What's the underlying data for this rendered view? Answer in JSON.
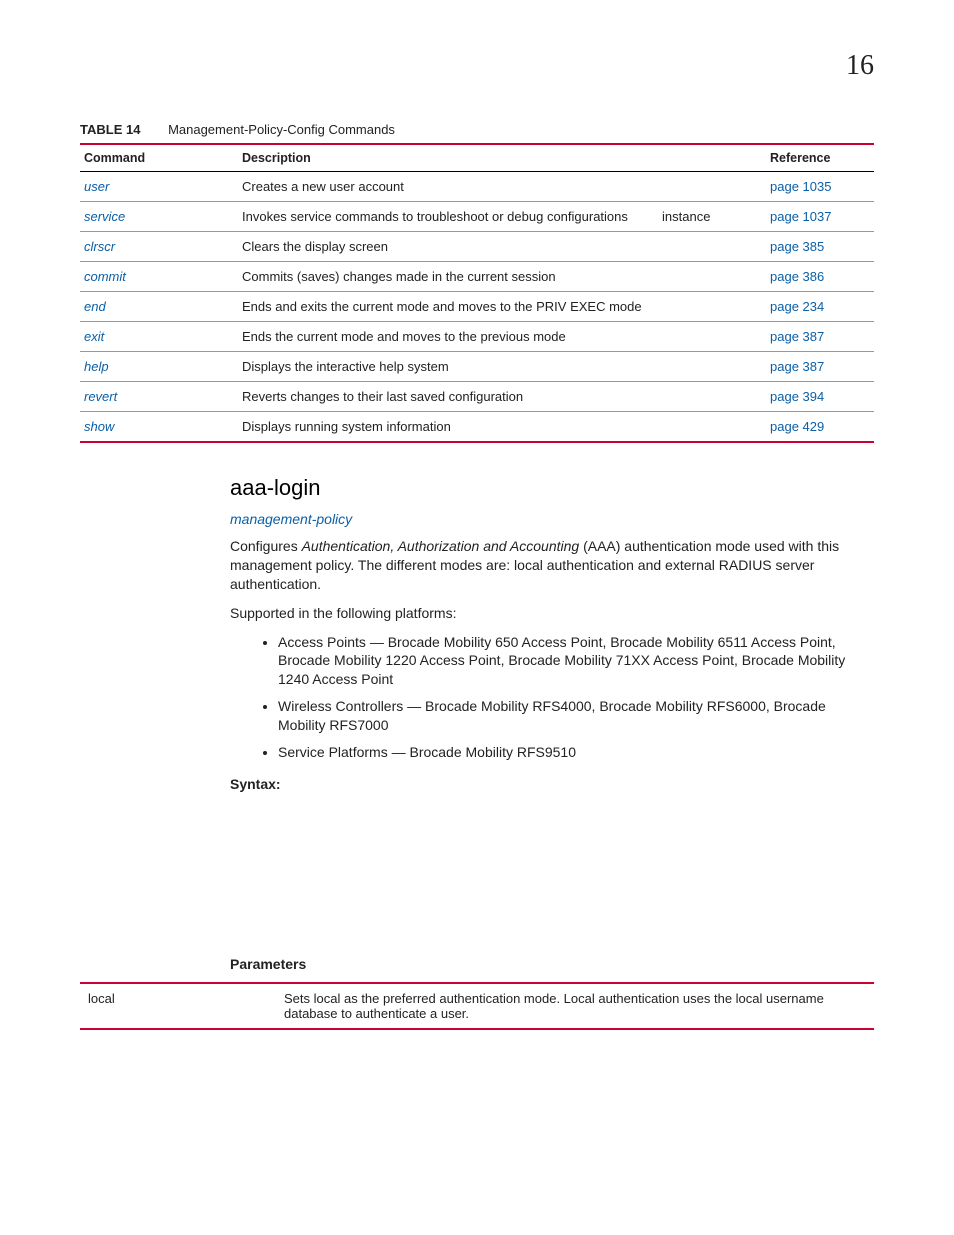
{
  "page_number": "16",
  "table_caption": {
    "label": "TABLE 14",
    "text": "Management-Policy-Config Commands"
  },
  "table_headers": {
    "command": "Command",
    "description": "Description",
    "reference": "Reference"
  },
  "commands": [
    {
      "cmd": "user",
      "desc": "Creates a new user account",
      "instance": "",
      "ref": "page 1035"
    },
    {
      "cmd": "service",
      "desc": "Invokes service commands to troubleshoot or debug configurations",
      "instance": "instance",
      "ref": "page 1037"
    },
    {
      "cmd": "clrscr",
      "desc": "Clears the display screen",
      "instance": "",
      "ref": "page 385"
    },
    {
      "cmd": "commit",
      "desc": "Commits (saves) changes made in the current session",
      "instance": "",
      "ref": "page 386"
    },
    {
      "cmd": "end",
      "desc": "Ends and exits the current mode and moves to the PRIV EXEC mode",
      "instance": "",
      "ref": "page 234"
    },
    {
      "cmd": "exit",
      "desc": "Ends the current mode and moves to the previous mode",
      "instance": "",
      "ref": "page 387"
    },
    {
      "cmd": "help",
      "desc": "Displays the interactive help system",
      "instance": "",
      "ref": "page 387"
    },
    {
      "cmd": "revert",
      "desc": "Reverts changes to their last saved configuration",
      "instance": "",
      "ref": "page 394"
    },
    {
      "cmd": "show",
      "desc": "Displays running system information",
      "instance": "",
      "ref": "page 429"
    }
  ],
  "section": {
    "title": "aaa-login",
    "link": "management-policy",
    "para1_pre": "Configures ",
    "para1_em": "Authentication, Authorization and Accounting",
    "para1_post": " (AAA) authentication mode used with this management policy. The different modes are: local authentication and external RADIUS server authentication.",
    "para2": "Supported in the following platforms:",
    "bullets": [
      "Access Points — Brocade Mobility 650 Access Point, Brocade Mobility 6511 Access Point, Brocade Mobility 1220 Access Point, Brocade Mobility 71XX Access Point, Brocade Mobility 1240 Access Point",
      "Wireless Controllers — Brocade Mobility RFS4000, Brocade Mobility RFS6000, Brocade Mobility RFS7000",
      "Service Platforms — Brocade Mobility RFS9510"
    ],
    "syntax_label": "Syntax:",
    "parameters_label": "Parameters",
    "params": [
      {
        "name": "local",
        "desc": "Sets local as the preferred authentication mode. Local authentication uses the local username database to authenticate a user."
      }
    ]
  }
}
